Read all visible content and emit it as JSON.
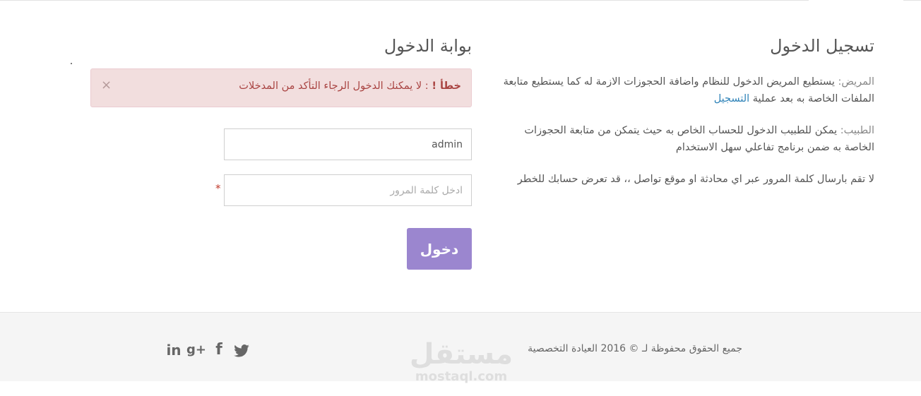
{
  "info": {
    "title": "تسجيل الدخول",
    "patient_label": "المريض:",
    "patient_text": "يستطيع المريض الدخول للنظام واضافة الحجوزات الازمة له كما يستطيع متابعة الملفات الخاصة به بعد عملية",
    "patient_link": "التسجيل",
    "doctor_label": "الطبيب:",
    "doctor_text": "يمكن للطبيب الدخول للحساب الخاص به حيث يتمكن من متابعة الحجوزات الخاصة به ضمن برنامج تفاعلي سهل الاستخدام",
    "warning_text": "لا تقم بارسال كلمة المرور عبر اي محادثة او موقع تواصل ،، قد تعرض حسابك للخطر"
  },
  "login": {
    "title": "بوابة الدخول",
    "alert_strong": "خطأ !",
    "alert_text": " : لا يمكنك الدخول الرجاء التأكد من المدخلات",
    "alert_close": "×",
    "username_value": "admin",
    "password_placeholder": "ادخل كلمة المرور",
    "required_mark": "*",
    "submit_label": "دخول"
  },
  "footer": {
    "copyright": "جميع الحقوق محفوظة لـ © 2016 العيادة التخصصية",
    "social": [
      "linkedin-icon",
      "google-plus-icon",
      "facebook-icon",
      "twitter-icon"
    ]
  },
  "watermark": {
    "arabic": "مستقل",
    "latin": "mostaql.com"
  },
  "colors": {
    "button": "#9b86cf",
    "alert_bg": "#f2dede",
    "alert_text": "#a94442",
    "link": "#2f83b8",
    "footer_bg": "#f5f5f5"
  }
}
